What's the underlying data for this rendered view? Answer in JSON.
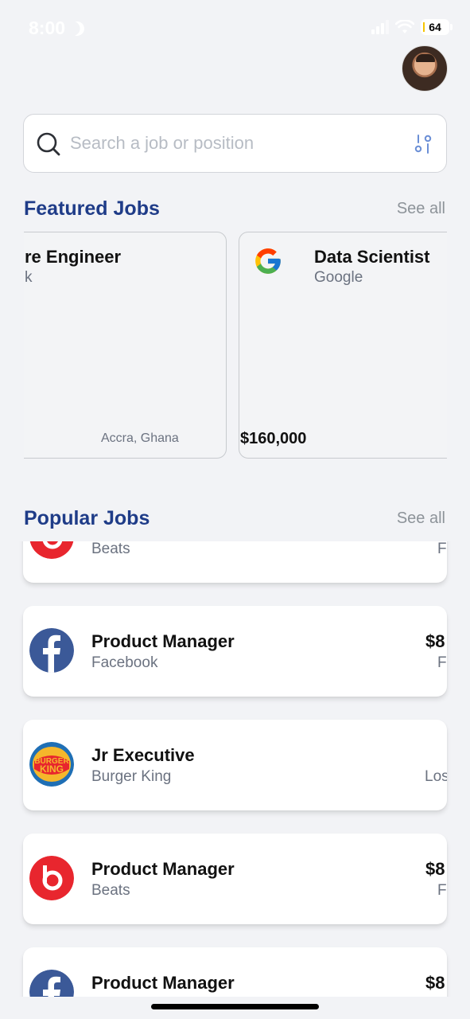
{
  "status_bar": {
    "time": "8:00",
    "battery": "64"
  },
  "search": {
    "placeholder": "Search a job or position"
  },
  "featured": {
    "title": "Featured Jobs",
    "see_all": "See all",
    "jobs": [
      {
        "title": "re Engineer",
        "company": "k",
        "location": "Accra, Ghana"
      },
      {
        "title": "Data Scientist",
        "company": "Google",
        "salary": "$160,000"
      }
    ]
  },
  "popular": {
    "title": "Popular Jobs",
    "see_all": "See all",
    "jobs": [
      {
        "title": "",
        "company": "Beats",
        "salary": "",
        "meta": "F",
        "logo": "beats-logo"
      },
      {
        "title": "Product Manager",
        "company": "Facebook",
        "salary": "$8",
        "meta": "F",
        "logo": "facebook-logo"
      },
      {
        "title": "Jr Executive",
        "company": "Burger King",
        "salary": "",
        "meta": "Los",
        "logo": "burger-king-logo"
      },
      {
        "title": "Product Manager",
        "company": "Beats",
        "salary": "$8",
        "meta": "F",
        "logo": "beats-logo"
      },
      {
        "title": "Product Manager",
        "company": "",
        "salary": "$8",
        "meta": "",
        "logo": "facebook-logo"
      }
    ]
  },
  "colors": {
    "accent": "#1f3c88",
    "background": "#f2f3f6",
    "beats_red": "#e8262e",
    "facebook_blue": "#3b5998"
  }
}
